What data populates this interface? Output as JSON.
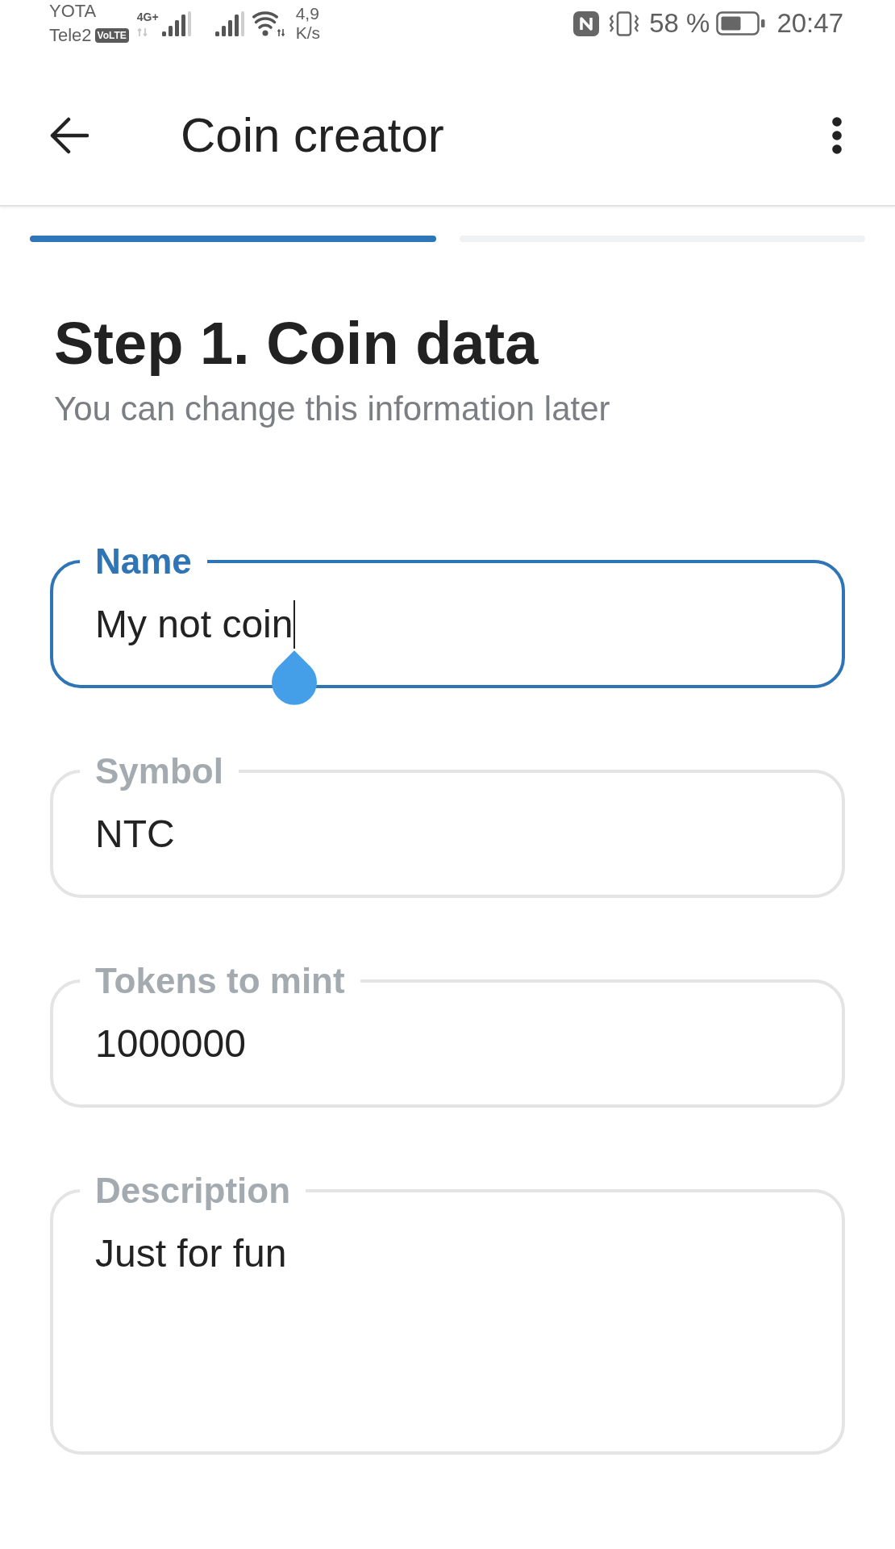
{
  "status_bar": {
    "carrier_1": "YOTA",
    "carrier_2": "Tele2",
    "volte_badge": "VoLTE",
    "network_type": "4G+",
    "net_speed": "4,9",
    "net_speed_unit": "K/s",
    "battery": "58 %",
    "time": "20:47"
  },
  "app_bar": {
    "title": "Coin creator"
  },
  "stepper": {
    "segments": [
      {
        "completed": true
      },
      {
        "completed": false
      }
    ]
  },
  "step": {
    "heading": "Step 1. Coin data",
    "subtitle": "You can change this information later"
  },
  "fields": [
    {
      "kind": "single_line",
      "label": "Name",
      "value": "My not coin",
      "focused": true
    },
    {
      "kind": "single_line",
      "label": "Symbol",
      "value": "NTC",
      "focused": false
    },
    {
      "kind": "single_line",
      "label": "Tokens to mint",
      "value": "1000000",
      "focused": false
    },
    {
      "kind": "multiline",
      "label": "Description",
      "value": "Just for fun",
      "focused": false
    }
  ]
}
